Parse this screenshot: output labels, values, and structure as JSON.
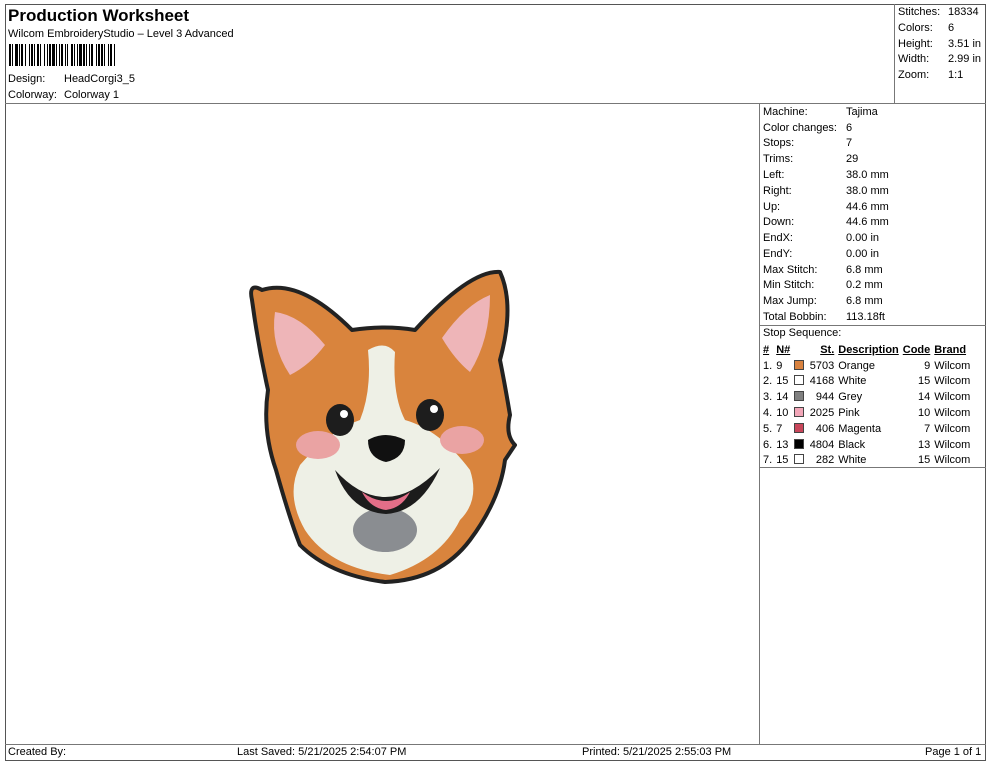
{
  "header": {
    "title": "Production Worksheet",
    "subtitle": "Wilcom EmbroideryStudio – Level 3 Advanced",
    "design_label": "Design:",
    "design_value": "HeadCorgi3_5",
    "colorway_label": "Colorway:",
    "colorway_value": "Colorway 1"
  },
  "stats": [
    {
      "label": "Stitches:",
      "value": "18334"
    },
    {
      "label": "Colors:",
      "value": "6"
    },
    {
      "label": "Height:",
      "value": "3.51 in"
    },
    {
      "label": "Width:",
      "value": "2.99 in"
    },
    {
      "label": "Zoom:",
      "value": "1:1"
    }
  ],
  "specs": [
    {
      "label": "Machine:",
      "value": "Tajima"
    },
    {
      "label": "Color changes:",
      "value": "6"
    },
    {
      "label": "Stops:",
      "value": "7"
    },
    {
      "label": "Trims:",
      "value": "29"
    },
    {
      "label": "Left:",
      "value": "38.0 mm"
    },
    {
      "label": "Right:",
      "value": "38.0 mm"
    },
    {
      "label": "Up:",
      "value": "44.6 mm"
    },
    {
      "label": "Down:",
      "value": "44.6 mm"
    },
    {
      "label": "EndX:",
      "value": "0.00 in"
    },
    {
      "label": "EndY:",
      "value": "0.00 in"
    },
    {
      "label": "Max Stitch:",
      "value": "6.8 mm"
    },
    {
      "label": "Min Stitch:",
      "value": "0.2 mm"
    },
    {
      "label": "Max Jump:",
      "value": "6.8 mm"
    },
    {
      "label": "Total Bobbin:",
      "value": "113.18ft"
    }
  ],
  "stop_sequence": {
    "heading": "Stop Sequence:",
    "columns": [
      "#",
      "N#",
      "St.",
      "Description",
      "Code",
      "Brand"
    ],
    "rows": [
      {
        "idx": "1.",
        "n": "9",
        "color": "#d9823f",
        "st": "5703",
        "desc": "Orange",
        "code": "9",
        "brand": "Wilcom"
      },
      {
        "idx": "2.",
        "n": "15",
        "color": "#ffffff",
        "st": "4168",
        "desc": "White",
        "code": "15",
        "brand": "Wilcom"
      },
      {
        "idx": "3.",
        "n": "14",
        "color": "#808080",
        "st": "944",
        "desc": "Grey",
        "code": "14",
        "brand": "Wilcom"
      },
      {
        "idx": "4.",
        "n": "10",
        "color": "#f2a6b8",
        "st": "2025",
        "desc": "Pink",
        "code": "10",
        "brand": "Wilcom"
      },
      {
        "idx": "5.",
        "n": "7",
        "color": "#c8465a",
        "st": "406",
        "desc": "Magenta",
        "code": "7",
        "brand": "Wilcom"
      },
      {
        "idx": "6.",
        "n": "13",
        "color": "#000000",
        "st": "4804",
        "desc": "Black",
        "code": "13",
        "brand": "Wilcom"
      },
      {
        "idx": "7.",
        "n": "15",
        "color": "#ffffff",
        "st": "282",
        "desc": "White",
        "code": "15",
        "brand": "Wilcom"
      }
    ]
  },
  "footer": {
    "created_by": "Created By:",
    "last_saved": "Last Saved: 5/21/2025 2:54:07 PM",
    "printed": "Printed: 5/21/2025 2:55:03 PM",
    "page": "Page 1 of 1"
  }
}
